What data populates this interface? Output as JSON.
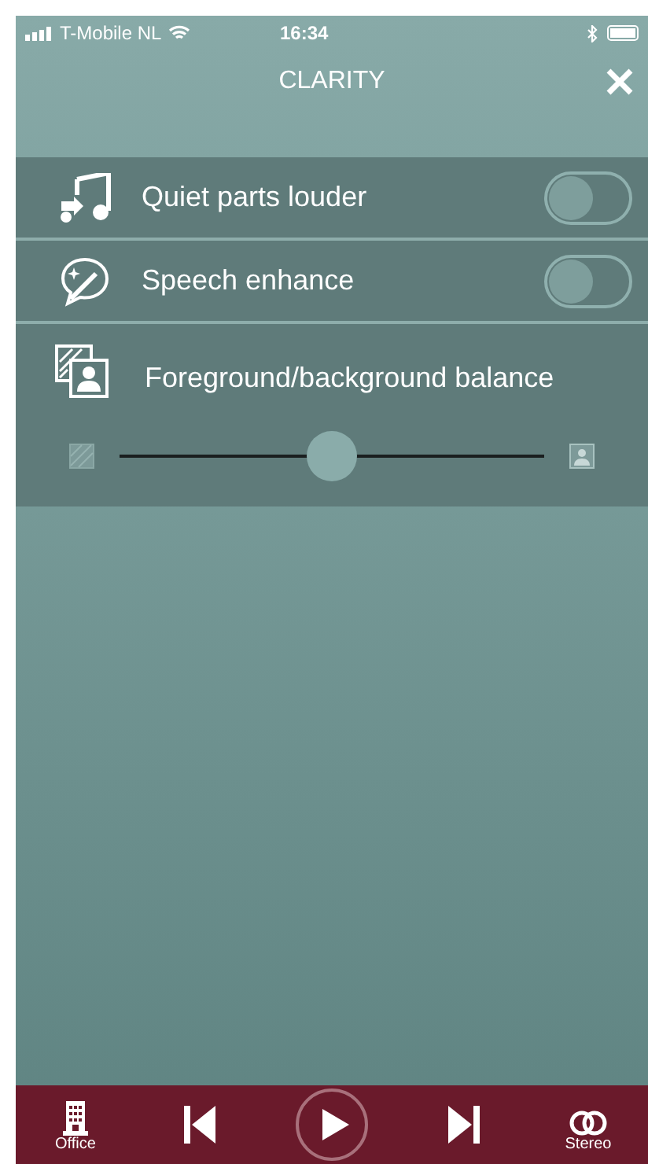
{
  "status_bar": {
    "carrier": "T-Mobile NL",
    "time": "16:34"
  },
  "header": {
    "title": "CLARITY"
  },
  "settings": [
    {
      "kind": "toggle",
      "label": "Quiet parts louder",
      "on": false
    },
    {
      "kind": "toggle",
      "label": "Speech enhance",
      "on": false
    },
    {
      "kind": "slider",
      "label": "Foreground/background balance",
      "level": 0.5
    }
  ],
  "bottom_bar": {
    "items": [
      {
        "kind": "labeled",
        "label": "Office"
      },
      {
        "kind": "previous"
      },
      {
        "kind": "play"
      },
      {
        "kind": "next"
      },
      {
        "kind": "labeled",
        "label": "Stereo"
      }
    ]
  }
}
